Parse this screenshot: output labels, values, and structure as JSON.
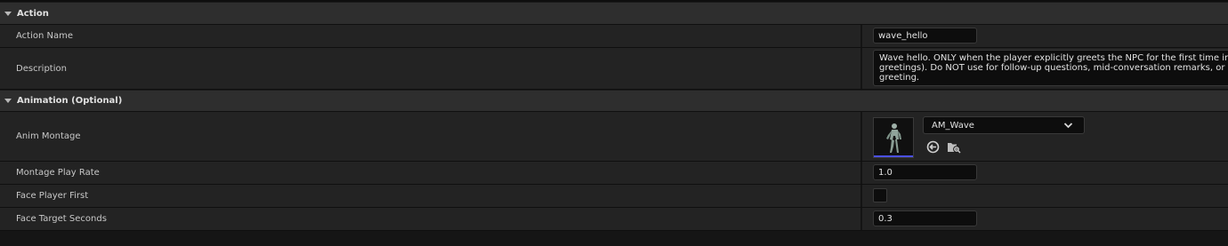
{
  "sections": {
    "action": {
      "title": "Action",
      "action_name": {
        "label": "Action Name",
        "value": "wave_hello"
      },
      "description": {
        "label": "Description",
        "lines": [
          "Wave hello. ONLY when the player explicitly greets the NPC for the first time in a",
          "greetings). Do NOT use for follow-up questions, mid-conversation remarks, or an",
          "greeting."
        ]
      }
    },
    "animation": {
      "title": "Animation (Optional)",
      "anim_montage": {
        "label": "Anim Montage",
        "asset": "AM_Wave"
      },
      "montage_play_rate": {
        "label": "Montage Play Rate",
        "value": "1.0"
      },
      "face_player_first": {
        "label": "Face Player First",
        "checked": false
      },
      "face_target_seconds": {
        "label": "Face Target Seconds",
        "value": "0.3"
      }
    }
  },
  "icons": {
    "section_arrow": "triangle-down-icon",
    "combo_arrow": "chevron-down-icon",
    "use_selected": "arrow-left-circle-icon",
    "browse": "folder-search-icon",
    "thumbnail": "character-animation-thumbnail"
  },
  "colors": {
    "background": "#151515",
    "row": "#232323",
    "header": "#2e2e2e",
    "input": "#0d0d0d",
    "thumbnail_accent": "#4b50e6"
  }
}
